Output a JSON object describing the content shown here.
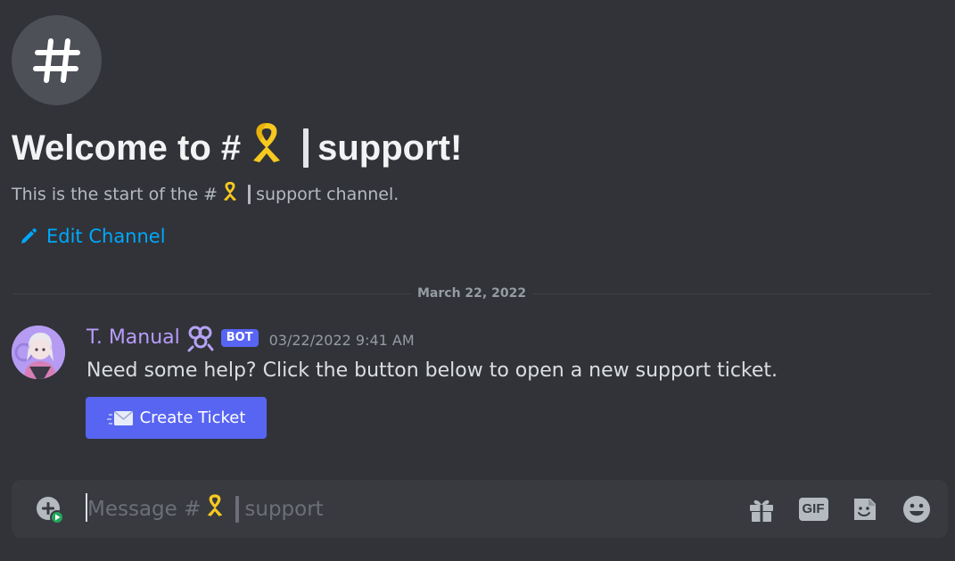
{
  "channel": {
    "welcome_prefix": "Welcome to #",
    "welcome_suffix": "support!",
    "start_prefix": "This is the start of the #",
    "start_suffix": "support channel.",
    "edit_label": "Edit Channel",
    "icon": "hashtag-icon",
    "emoji": "yellow-ribbon-icon"
  },
  "divider": {
    "date": "March 22, 2022"
  },
  "message": {
    "author": "T. Manual",
    "role_icon": "pretzel-role-icon",
    "tag": "BOT",
    "timestamp": "03/22/2022 9:41 AM",
    "content": "Need some help? Click the button below to open a new support ticket.",
    "button_label": "Create Ticket",
    "button_icon": "envelope-icon"
  },
  "composer": {
    "placeholder_prefix": "Message #",
    "placeholder_suffix": "support",
    "gif_label": "GIF",
    "icons": [
      "add-attachment-icon",
      "gift-icon",
      "gif-icon",
      "sticker-icon",
      "emoji-icon"
    ]
  },
  "colors": {
    "background": "#313338",
    "composer": "#383a40",
    "blurple": "#5865f2",
    "link": "#00a8fc",
    "author": "#b89cfc",
    "ribbon": "#f7c91f"
  }
}
